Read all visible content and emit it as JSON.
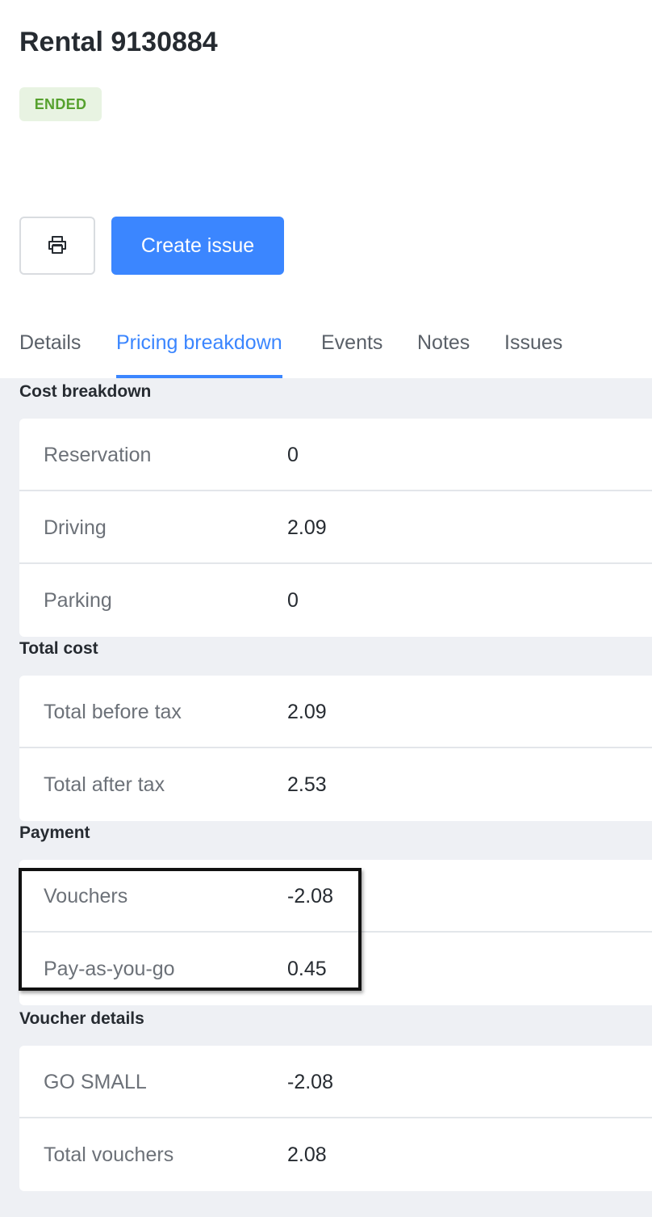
{
  "header": {
    "title": "Rental 9130884",
    "status": "ENDED"
  },
  "actions": {
    "print_icon": "printer-icon",
    "create_issue_label": "Create issue"
  },
  "tabs": [
    {
      "label": "Details"
    },
    {
      "label": "Pricing breakdown",
      "active": true
    },
    {
      "label": "Events"
    },
    {
      "label": "Notes"
    },
    {
      "label": "Issues"
    }
  ],
  "cost_breakdown": {
    "title": "Cost breakdown",
    "rows": [
      {
        "label": "Reservation",
        "value": "0"
      },
      {
        "label": "Driving",
        "value": "2.09"
      },
      {
        "label": "Parking",
        "value": "0"
      }
    ]
  },
  "total_cost": {
    "title": "Total cost",
    "rows": [
      {
        "label": "Total before tax",
        "value": "2.09"
      },
      {
        "label": "Total after tax",
        "value": "2.53"
      }
    ]
  },
  "payment": {
    "title": "Payment",
    "rows": [
      {
        "label": "Vouchers",
        "value": "-2.08"
      },
      {
        "label": "Pay-as-you-go",
        "value": "0.45"
      }
    ]
  },
  "voucher_details": {
    "title": "Voucher details",
    "rows": [
      {
        "label": "GO SMALL",
        "value": "-2.08"
      },
      {
        "label": "Total vouchers",
        "value": "2.08"
      }
    ]
  },
  "colors": {
    "accent": "#3b86ff",
    "status_badge_bg": "#e8f3e2",
    "status_badge_text": "#56a12e",
    "page_bg": "#eef0f4"
  }
}
